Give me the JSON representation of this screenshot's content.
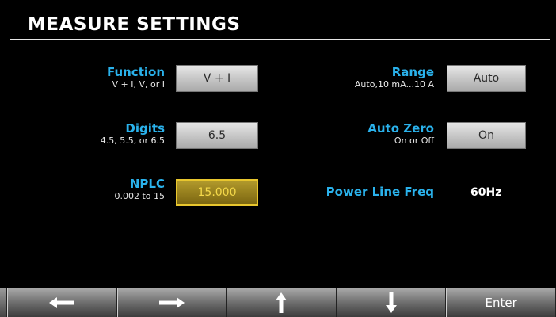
{
  "header": {
    "title": "MEASURE SETTINGS"
  },
  "settings": {
    "function": {
      "label": "Function",
      "hint": "V + I, V, or I",
      "value": "V + I"
    },
    "range": {
      "label": "Range",
      "hint": "Auto,10 mA...10 A",
      "value": "Auto"
    },
    "digits": {
      "label": "Digits",
      "hint": "4.5, 5.5, or 6.5",
      "value": "6.5"
    },
    "auto_zero": {
      "label": "Auto Zero",
      "hint": "On or Off",
      "value": "On"
    },
    "nplc": {
      "label": "NPLC",
      "hint": "0.002 to 15",
      "value": "15.000"
    },
    "power_line_freq": {
      "label": "Power Line Freq",
      "value": "60Hz"
    }
  },
  "softkeys": {
    "left": {
      "icon": "arrow-left-icon"
    },
    "right": {
      "icon": "arrow-right-icon"
    },
    "up": {
      "icon": "arrow-up-icon"
    },
    "down": {
      "icon": "arrow-down-icon"
    },
    "enter": {
      "label": "Enter"
    }
  },
  "colors": {
    "background": "#000000",
    "label_accent": "#2ab2ec",
    "active_border": "#e8c62e",
    "active_text": "#f5d94a"
  }
}
